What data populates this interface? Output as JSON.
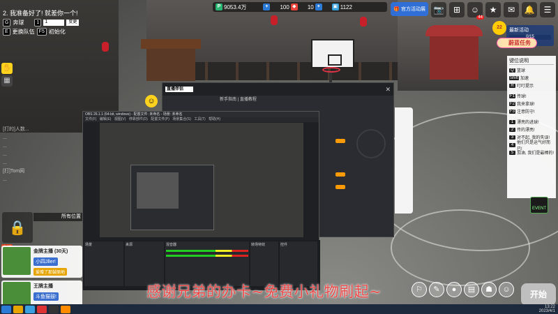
{
  "hud": {
    "currency_points": "9053.4万",
    "gems": "100",
    "tickets": "10",
    "coins": "1122",
    "blue_btn": "官方活动展"
  },
  "lobby": {
    "title": "2. 我准备好了! 就差你一个!",
    "row1_key": "G",
    "row1_label": "奔球",
    "row1_input": "1",
    "row1_btn": "变更",
    "row2_key1": "E",
    "row2_label1": "更换队伍",
    "row2_key2": "F5",
    "row2_label2": "初始化"
  },
  "chat": {
    "lines": [
      "[打的]人数...",
      "...",
      "...",
      "...",
      "...",
      "[打]Tom网",
      "..."
    ],
    "team_box": "所有位置",
    "red_tag": "主播"
  },
  "players": [
    {
      "name": "金牌主播 (30天)",
      "msg": "小四Jller!",
      "sub": "爱赠了那鼓丽地"
    },
    {
      "name": "王牌主播",
      "msg": "斗鱼猫鼓!",
      "sub": ""
    }
  ],
  "quest": {
    "level": "22",
    "title": "最新活动",
    "progress": "0/15",
    "tag": "蔚蓝任务"
  },
  "keyhelp": {
    "title": "键位说明",
    "rows": [
      {
        "k": "Q",
        "t": "篮球"
      },
      {
        "k": "Shift",
        "t": "加速"
      },
      {
        "k": "R",
        "t": "叮叮提示"
      },
      {
        "k": "F1",
        "t": "传球!"
      },
      {
        "k": "F2",
        "t": "我来拿球!"
      },
      {
        "k": "F3",
        "t": "注意防守!"
      },
      {
        "k": "1",
        "t": "漂亮的进球!"
      },
      {
        "k": "2",
        "t": "传的漂亮!"
      },
      {
        "k": "3",
        "t": "对不起, 我的失误!"
      },
      {
        "k": "4",
        "t": "他们只是运气好而已!"
      },
      {
        "k": "5",
        "t": "加油, 我们是最棒的!"
      }
    ],
    "event": "EVENT"
  },
  "app_window": {
    "logo": "直播伴侣",
    "meta": "新手指南 | 直播教程",
    "close": "✕"
  },
  "obs": {
    "title": "OBS 26.1.1 (64-bit, windows) - 配置文件: 未命名 - 场景: 未命名",
    "menu": "文件(F) 编辑(E) 视图(V) 停靠部件(D) 配置文件(P) 场景集合(S) 工具(T) 帮助(H)",
    "docks": [
      "场景",
      "来源",
      "混音器",
      "转场特效",
      "控件"
    ]
  },
  "subtitle": "感谢兄弟的办卡~免费小礼物刷起~",
  "start": "开始",
  "clock": {
    "time": "13:22",
    "date": "2023/4/1"
  }
}
